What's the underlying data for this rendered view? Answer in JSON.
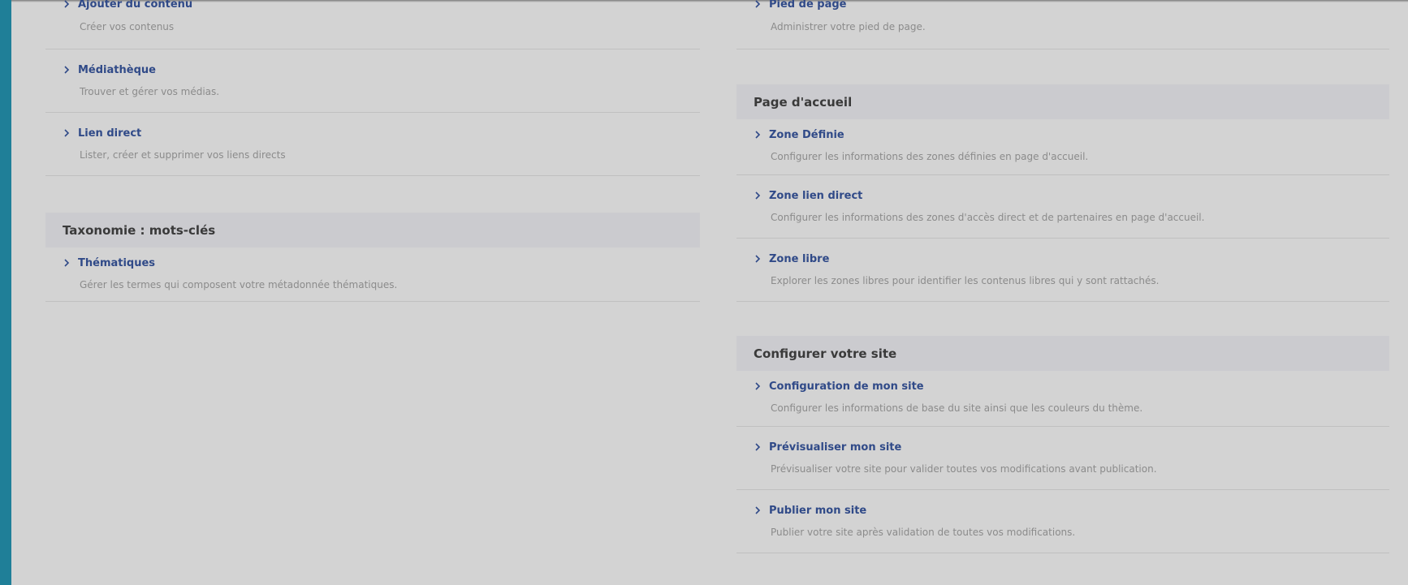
{
  "colors": {
    "accent_bar": "#1f7f98",
    "link": "#304a88",
    "background": "#d3d3d3",
    "section_header_bg": "#cbcbcf"
  },
  "left_column": {
    "top_items": [
      {
        "label": "Ajouter du contenu",
        "description": "Créer vos contenus"
      },
      {
        "label": "Médiathèque",
        "description": "Trouver et gérer vos médias."
      },
      {
        "label": "Lien direct",
        "description": "Lister, créer et supprimer vos liens directs"
      }
    ],
    "taxonomy": {
      "title": "Taxonomie : mots-clés",
      "items": [
        {
          "label": "Thématiques",
          "description": "Gérer les termes qui composent votre métadonnée thématiques."
        }
      ]
    }
  },
  "right_column": {
    "top_items": [
      {
        "label": "Pied de page",
        "description": "Administrer votre pied de page."
      }
    ],
    "homepage": {
      "title": "Page d'accueil",
      "items": [
        {
          "label": "Zone Définie",
          "description": "Configurer les informations des zones définies en page d'accueil."
        },
        {
          "label": "Zone lien direct",
          "description": "Configurer les informations des zones d'accès direct et de partenaires en page d'accueil."
        },
        {
          "label": "Zone libre",
          "description": "Explorer les zones libres pour identifier les contenus libres qui y sont rattachés."
        }
      ]
    },
    "site_config": {
      "title": "Configurer votre site",
      "items": [
        {
          "label": "Configuration de mon site",
          "description": "Configurer les informations de base du site ainsi que les couleurs du thème."
        },
        {
          "label": "Prévisualiser mon site",
          "description": "Prévisualiser votre site pour valider toutes vos modifications avant publication."
        },
        {
          "label": "Publier mon site",
          "description": "Publier votre site après validation de toutes vos modifications."
        }
      ]
    }
  }
}
